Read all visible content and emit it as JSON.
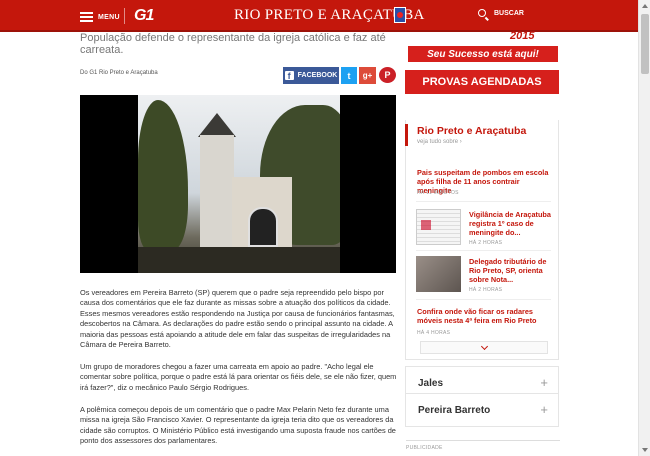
{
  "header": {
    "menu_label": "MENU",
    "site_logo": "G1",
    "section_title": "RIO PRETO E ARAÇATUBA",
    "search_label": "BUSCAR"
  },
  "article": {
    "subtitle": "População defende o representante da igreja católica e faz até carreata.",
    "credit": "Do G1 Rio Preto e Araçatuba",
    "share": {
      "facebook": "FACEBOOK",
      "twitter": "t",
      "googleplus": "g+",
      "pinterest": "P"
    },
    "paragraphs": [
      "Os vereadores em Pereira Barreto (SP) querem que o padre seja repreendido pelo bispo por causa dos comentários que ele faz durante as missas sobre a atuação dos políticos da cidade. Esses mesmos vereadores estão respondendo na Justiça por causa de funcionários fantasmas, descobertos na Câmara. As declarações do padre estão sendo o principal assunto na cidade. A maioria das pessoas está apoiando a atitude dele em falar das suspeitas de irregularidades na Câmara de Pereira Barreto.",
      "Um grupo de moradores chegou a fazer uma carreata em apoio ao padre. \"Acho legal ele comentar sobre política, porque o padre está lá para orientar os fiéis dele, se ele não fizer, quem irá fazer?\", diz o mecânico Paulo Sérgio Rodrigues.",
      "A polêmica começou depois de um comentário que o padre Max Pelarin Neto fez durante uma missa na igreja São Francisco Xavier. O representante da igreja teria dito que os vereadores da cidade são corruptos. O Ministério Público está investigando uma suposta fraude nos cartões de ponto dos assessores dos parlamentares."
    ]
  },
  "sidebar": {
    "banner_year": "2015",
    "banner_slogan": "Seu Sucesso está aqui!",
    "banner_cta": "PROVAS AGENDADAS",
    "box_title": "Rio Preto e Araçatuba",
    "box_subtitle": "veja tudo sobre ›",
    "news": [
      {
        "title": "Pais suspeitam de pombos em escola após filha de 11 anos contrair meningite",
        "time": "HÁ 11 MINUTOS"
      },
      {
        "title": "Vigilância de Araçatuba registra 1º caso de meningite do...",
        "time": "HÁ 2 HORAS"
      },
      {
        "title": "Delegado tributário de Rio Preto, SP, orienta sobre Nota...",
        "time": "HÁ 2 HORAS"
      },
      {
        "title": "Confira onde vão ficar os radares móveis nesta 4ª feira em Rio Preto",
        "time": "HÁ 4 HORAS"
      }
    ],
    "cities": [
      "Jales",
      "Pereira Barreto"
    ],
    "publicidade": "PUBLICIDADE"
  },
  "icons": {
    "menu": "hamburger-icon",
    "search": "search-icon",
    "expand": "plus-icon",
    "more": "chevron-down-icon"
  },
  "colors": {
    "brand_red": "#c4170c",
    "banner_red": "#d6201c",
    "facebook": "#3b5998",
    "twitter": "#1da1f2",
    "googleplus": "#dd4b39",
    "pinterest": "#cb2027"
  }
}
